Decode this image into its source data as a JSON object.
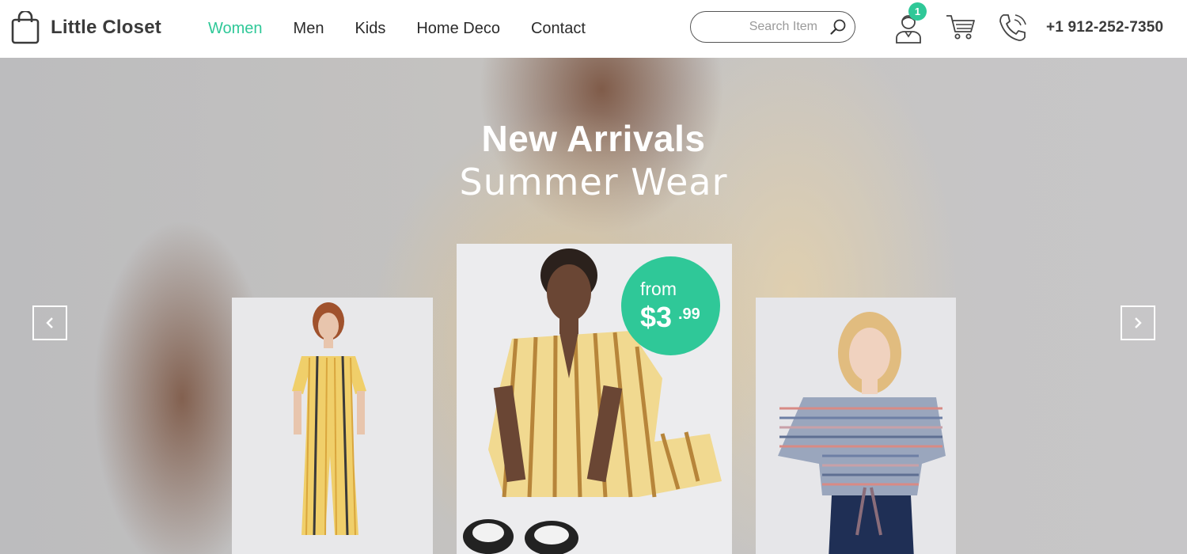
{
  "brand": {
    "name": "Little Closet"
  },
  "nav": {
    "items": [
      {
        "label": "Women",
        "active": true
      },
      {
        "label": "Men",
        "active": false
      },
      {
        "label": "Kids",
        "active": false
      },
      {
        "label": "Home Deco",
        "active": false
      },
      {
        "label": "Contact",
        "active": false
      }
    ]
  },
  "search": {
    "placeholder": "Search Item",
    "value": ""
  },
  "account": {
    "badge_count": "1"
  },
  "contact": {
    "phone": "+1 912-252-7350"
  },
  "hero": {
    "title": "New Arrivals",
    "subtitle": "Summer Wear",
    "price": {
      "prefix": "from",
      "amount": "$3",
      "cents": ".99"
    }
  },
  "colors": {
    "accent": "#2fc898",
    "text": "#3b3b3b"
  },
  "icons": {
    "logo": "shopping-bag-icon",
    "search": "search-icon",
    "user": "user-icon",
    "cart": "cart-icon",
    "phone": "phone-icon",
    "prev": "chevron-left-icon",
    "next": "chevron-right-icon"
  }
}
